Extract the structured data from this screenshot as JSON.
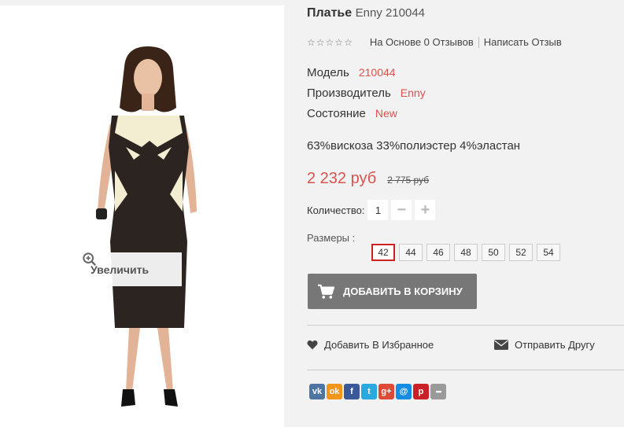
{
  "product": {
    "title_bold": "Платье",
    "title_rest": "Enny 210044",
    "zoom_label": "Увеличить"
  },
  "rating": {
    "stars_filled": 0,
    "stars_total": 5,
    "reviews_link": "На Основе 0 Отзывов",
    "write_review": "Написать Отзыв"
  },
  "specs": [
    {
      "label": "Модель",
      "value": "210044"
    },
    {
      "label": "Производитель",
      "value": "Enny"
    },
    {
      "label": "Состояние",
      "value": "New"
    }
  ],
  "composition": "63%вискоза 33%полиэстер 4%эластан",
  "price": {
    "current": "2 232 руб",
    "old": "2 775 руб"
  },
  "quantity": {
    "label": "Количество:",
    "value": "1",
    "minus": "−",
    "plus": "+"
  },
  "sizes": {
    "label": "Размеры :",
    "options": [
      "42",
      "44",
      "46",
      "48",
      "50",
      "52",
      "54"
    ],
    "selected": "42"
  },
  "cart": {
    "label": "ДОБАВИТЬ В КОРЗИНУ"
  },
  "actions": {
    "favorite": "Добавить В Избранное",
    "send_friend": "Отправить Другу"
  },
  "social": [
    {
      "name": "vk-icon",
      "glyph": "vk",
      "color": "#4c75a3"
    },
    {
      "name": "odnoklassniki-icon",
      "glyph": "ok",
      "color": "#f2951c"
    },
    {
      "name": "facebook-icon",
      "glyph": "f",
      "color": "#3b5998"
    },
    {
      "name": "twitter-icon",
      "glyph": "t",
      "color": "#2aa9e0"
    },
    {
      "name": "google-plus-icon",
      "glyph": "g+",
      "color": "#dc4a38"
    },
    {
      "name": "mail-icon",
      "glyph": "@",
      "color": "#168de2"
    },
    {
      "name": "pinterest-icon",
      "glyph": "p",
      "color": "#cb2027"
    },
    {
      "name": "more-icon",
      "glyph": "•••",
      "color": "#9a9a9a"
    }
  ],
  "colors": {
    "accent": "#d9534f",
    "button": "#777777",
    "selected_size_border": "#cc2222"
  }
}
